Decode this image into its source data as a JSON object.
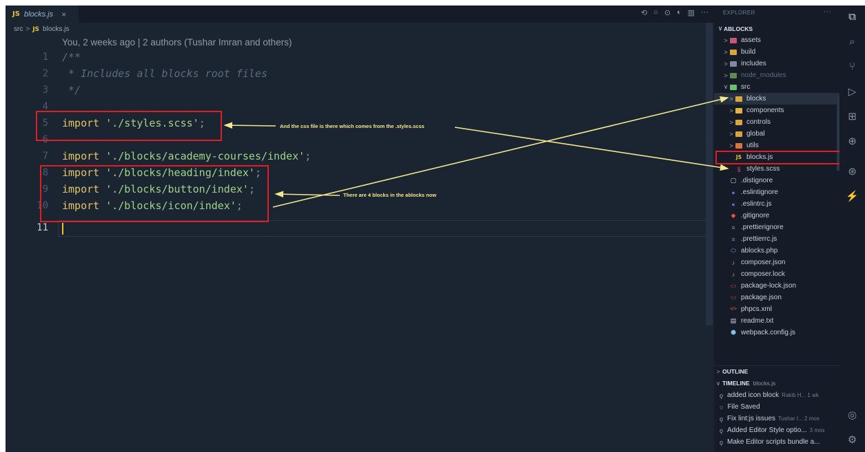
{
  "tab": {
    "badge": "JS",
    "file": "blocks.js",
    "close": "×"
  },
  "tab_actions": [
    "⟲",
    "○",
    "⊙",
    "◐",
    "▥",
    "···"
  ],
  "breadcrumb": {
    "folder": "src",
    "sep": ">",
    "badge": "JS",
    "file": "blocks.js"
  },
  "blame": "You, 2 weeks ago | 2 authors (Tushar Imran and others)",
  "code_lines": [
    {
      "num": "1",
      "text": "/**"
    },
    {
      "num": "2",
      "text": " * Includes all blocks root files"
    },
    {
      "num": "3",
      "text": " */"
    },
    {
      "num": "4",
      "text": ""
    },
    {
      "num": "5",
      "kw": "import",
      "str": "'./styles.scss'",
      "semi": ";"
    },
    {
      "num": "6",
      "text": ""
    },
    {
      "num": "7",
      "kw": "import",
      "str": "'./blocks/academy-courses/index'",
      "semi": ";"
    },
    {
      "num": "8",
      "kw": "import",
      "str": "'./blocks/heading/index'",
      "semi": ";"
    },
    {
      "num": "9",
      "kw": "import",
      "str": "'./blocks/button/index'",
      "semi": ";"
    },
    {
      "num": "10",
      "kw": "import",
      "str": "'./blocks/icon/index'",
      "semi": ";"
    },
    {
      "num": "11",
      "text": ""
    }
  ],
  "annotations": {
    "css_note": "And the css file is there which comes from the .styles.scss",
    "blocks_note": "There are 4 blocks in the ablocks now"
  },
  "explorer": {
    "title": "EXPLORER",
    "more": "···",
    "root": "ABLOCKS",
    "items": [
      {
        "label": "assets",
        "type": "folder",
        "chev": ">"
      },
      {
        "label": "build",
        "type": "folder",
        "chev": ">"
      },
      {
        "label": "includes",
        "type": "folder",
        "chev": ">"
      },
      {
        "label": "node_modules",
        "type": "folder",
        "chev": ">"
      },
      {
        "label": "src",
        "type": "folder",
        "chev": "∨"
      },
      {
        "label": "blocks",
        "type": "folder",
        "chev": ">"
      },
      {
        "label": "components",
        "type": "folder",
        "chev": ">"
      },
      {
        "label": "controls",
        "type": "folder",
        "chev": ">"
      },
      {
        "label": "global",
        "type": "folder",
        "chev": ">"
      },
      {
        "label": "utils",
        "type": "folder",
        "chev": ">"
      },
      {
        "label": "blocks.js",
        "type": "file",
        "icon": "JS"
      },
      {
        "label": "styles.scss",
        "type": "file",
        "icon": "§"
      },
      {
        "label": ".distignore",
        "type": "file",
        "icon": "▢"
      },
      {
        "label": ".eslintignore",
        "type": "file",
        "icon": "●"
      },
      {
        "label": ".eslintrc.js",
        "type": "file",
        "icon": "●"
      },
      {
        "label": ".gitignore",
        "type": "file",
        "icon": "◆"
      },
      {
        "label": ".prettierignore",
        "type": "file",
        "icon": "≡"
      },
      {
        "label": ".prettierrc.js",
        "type": "file",
        "icon": "≡"
      },
      {
        "label": "ablocks.php",
        "type": "file",
        "icon": "⬭"
      },
      {
        "label": "composer.json",
        "type": "file",
        "icon": "♪"
      },
      {
        "label": "composer.lock",
        "type": "file",
        "icon": "♪"
      },
      {
        "label": "package-lock.json",
        "type": "file",
        "icon": "▭"
      },
      {
        "label": "package.json",
        "type": "file",
        "icon": "▭"
      },
      {
        "label": "phpcs.xml",
        "type": "file",
        "icon": "</>"
      },
      {
        "label": "readme.txt",
        "type": "file",
        "icon": "▤"
      },
      {
        "label": "webpack.config.js",
        "type": "file",
        "icon": "⬢"
      }
    ]
  },
  "outline": {
    "chev": ">",
    "label": "OUTLINE"
  },
  "timeline": {
    "chev": "∨",
    "label": "TIMELINE",
    "file": "blocks.js",
    "items": [
      {
        "dot": "ǫ",
        "text": "added icon block",
        "meta": "Rakib H... 1 wk"
      },
      {
        "dot": "○",
        "text": "File Saved",
        "meta": ""
      },
      {
        "dot": "ǫ",
        "text": "Fix lint:js issues",
        "meta": "Tushar I... 2 mos"
      },
      {
        "dot": "ǫ",
        "text": "Added Editor Style optio...",
        "meta": "3 mos"
      },
      {
        "dot": "ǫ",
        "text": "Make Editor scripts bundle a...",
        "meta": ""
      }
    ]
  },
  "activity": [
    "⧉",
    "⌕",
    "⑂",
    "▷",
    "⊞",
    "⊕",
    "⊛",
    "⚡",
    "◎",
    "⚙"
  ],
  "colors": {
    "annotation_red": "#e01e26",
    "annotation_arrow": "#f3e88d",
    "editor_bg": "#1b2431",
    "sidebar_bg": "#151c27"
  }
}
